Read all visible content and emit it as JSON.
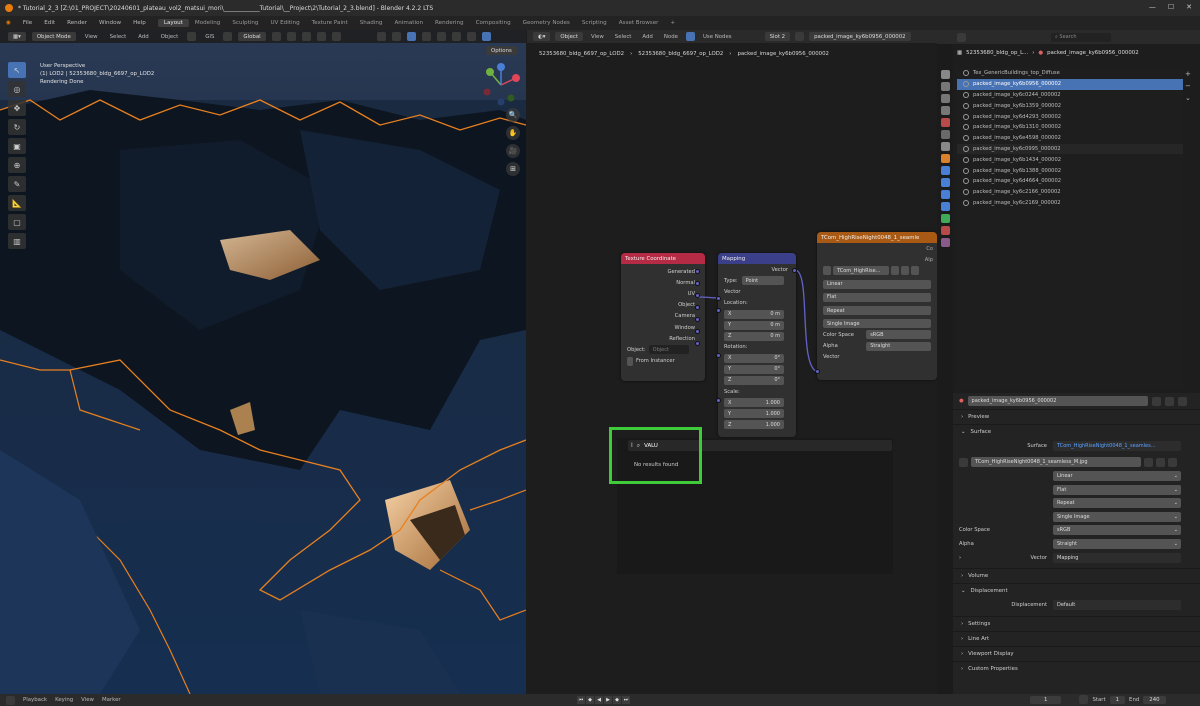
{
  "window": {
    "title": "* Tutorial_2_3 [Z:\\01_PROJECT\\20240601_plateau_vol2_matsui_mori\\____________Tutorial\\__Project\\2\\Tutorial_2_3.blend] - Blender 4.2.2 LTS",
    "controls": [
      "—",
      "☐",
      "✕"
    ]
  },
  "menubar": {
    "menus": [
      "File",
      "Edit",
      "Render",
      "Window",
      "Help"
    ],
    "workspaces": [
      "Layout",
      "Modeling",
      "Sculpting",
      "UV Editing",
      "Texture Paint",
      "Shading",
      "Animation",
      "Rendering",
      "Compositing",
      "Geometry Nodes",
      "Scripting",
      "Asset Browser",
      "+"
    ]
  },
  "viewport": {
    "mode": "Object Mode",
    "menus": [
      "View",
      "Select",
      "Add",
      "Object"
    ],
    "gis_label": "GIS",
    "orientation": "Global",
    "options_label": "Options",
    "info": {
      "line1": "User Perspective",
      "line2": "(1) LOD2 | 52353680_bldg_6697_op_LOD2",
      "line3": "Rendering Done"
    },
    "tools": [
      "↖",
      "◎",
      "✥",
      "↻",
      "▣",
      "⊕",
      "✎",
      "📐",
      "▢",
      "▥"
    ],
    "nav_buttons": [
      "🔍",
      "✋",
      "🎥",
      "⊞"
    ]
  },
  "node_editor": {
    "object_label": "Object",
    "menus": [
      "View",
      "Select",
      "Add",
      "Node"
    ],
    "use_nodes_label": "Use Nodes",
    "slot": "Slot 2",
    "image_name": "packed_image_ky6b0956_000002",
    "breadcrumb": [
      "52353680_bldg_6697_op_LOD2",
      "52353680_bldg_6697_op_LOD2",
      "packed_image_ky6b0956_000002"
    ],
    "texcoord_node": {
      "title": "Texture Coordinate",
      "outputs": [
        "Generated",
        "Normal",
        "UV",
        "Object",
        "Camera",
        "Window",
        "Reflection"
      ],
      "object_label": "Object:",
      "object_placeholder": "Object",
      "from_instancer": "From Instancer"
    },
    "mapping_node": {
      "title": "Mapping",
      "output": "Vector",
      "type_label": "Type:",
      "type_value": "Point",
      "input_vector": "Vector",
      "location_label": "Location:",
      "location": [
        {
          "axis": "X",
          "value": "0 m"
        },
        {
          "axis": "Y",
          "value": "0 m"
        },
        {
          "axis": "Z",
          "value": "0 m"
        }
      ],
      "rotation_label": "Rotation:",
      "rotation": [
        {
          "axis": "X",
          "value": "0°"
        },
        {
          "axis": "Y",
          "value": "0°"
        },
        {
          "axis": "Z",
          "value": "0°"
        }
      ],
      "scale_label": "Scale:",
      "scale": [
        {
          "axis": "X",
          "value": "1.000"
        },
        {
          "axis": "Y",
          "value": "1.000"
        },
        {
          "axis": "Z",
          "value": "1.000"
        }
      ]
    },
    "image_node": {
      "title": "TCom_HighRiseNight0048_1_seamle",
      "image_field": "TCom_HighRise...",
      "right_labels": [
        "Co",
        "Alp"
      ],
      "interpolation": "Linear",
      "projection": "Flat",
      "extension": "Repeat",
      "source": "Single Image",
      "color_space_label": "Color Space",
      "color_space": "sRGB",
      "alpha_label": "Alpha",
      "alpha": "Straight",
      "input_vector": "Vector"
    },
    "search": {
      "value": "VALU",
      "no_results": "No results found"
    }
  },
  "properties": {
    "search_placeholder": "Search",
    "image_header": [
      "52353680_bldg_op_L...",
      "packed_image_ky6b0956_000002"
    ],
    "image_list": [
      {
        "name": "Tex_GenericBuildings_top_Diffuse",
        "state": "normal"
      },
      {
        "name": "packed_image_ky6b0956_000002",
        "state": "selected"
      },
      {
        "name": "packed_image_ky6c0244_000002",
        "state": "normal"
      },
      {
        "name": "packed_image_ky6b1359_000002",
        "state": "normal"
      },
      {
        "name": "packed_image_ky6d4293_000002",
        "state": "normal"
      },
      {
        "name": "packed_image_ky6b1310_000002",
        "state": "normal"
      },
      {
        "name": "packed_image_ky6e4598_000002",
        "state": "normal"
      },
      {
        "name": "packed_image_ky6c0995_000002",
        "state": "alt"
      },
      {
        "name": "packed_image_ky6b1434_000002",
        "state": "normal"
      },
      {
        "name": "packed_image_ky6b1388_000002",
        "state": "normal"
      },
      {
        "name": "packed_image_ky6d4664_000002",
        "state": "normal"
      },
      {
        "name": "packed_image_ky6c2166_000002",
        "state": "normal"
      },
      {
        "name": "packed_image_ky6c2169_000002",
        "state": "normal"
      }
    ],
    "active_image": "packed_image_ky6b0956_000002",
    "panels": {
      "preview": "Preview",
      "surface": "Surface",
      "volume": "Volume",
      "displacement": "Displacement",
      "settings": "Settings",
      "line_art": "Line Art",
      "viewport_display": "Viewport Display",
      "custom_properties": "Custom Properties"
    },
    "surface_label": "Surface",
    "surface_value": "TCom_HighRiseNight0048_1_seamles...",
    "image_file": "TCom_HighRiseNight0048_1_seamless_M.jpg",
    "interpolation": "Linear",
    "projection": "Flat",
    "extension": "Repeat",
    "source": "Single Image",
    "color_space_label": "Color Space",
    "color_space": "sRGB",
    "alpha_label": "Alpha",
    "alpha": "Straight",
    "vector_label": "Vector",
    "vector_value": "Mapping",
    "displacement_label": "Displacement",
    "displacement_value": "Default"
  },
  "statusbar": {
    "items": [
      "Playback",
      "Keying",
      "View",
      "Marker"
    ],
    "current_frame": "1",
    "start_label": "Start",
    "start": "1",
    "end_label": "End",
    "end": "240"
  },
  "colors": {
    "accent": "#4772b3",
    "highlight_box": "#3fcc3a",
    "texcoord_header": "#b52a44",
    "mapping_header": "#3b3f8a",
    "image_header": "#a85a14",
    "vector_socket": "#6363c7",
    "selection_outline": "#e8801f"
  }
}
